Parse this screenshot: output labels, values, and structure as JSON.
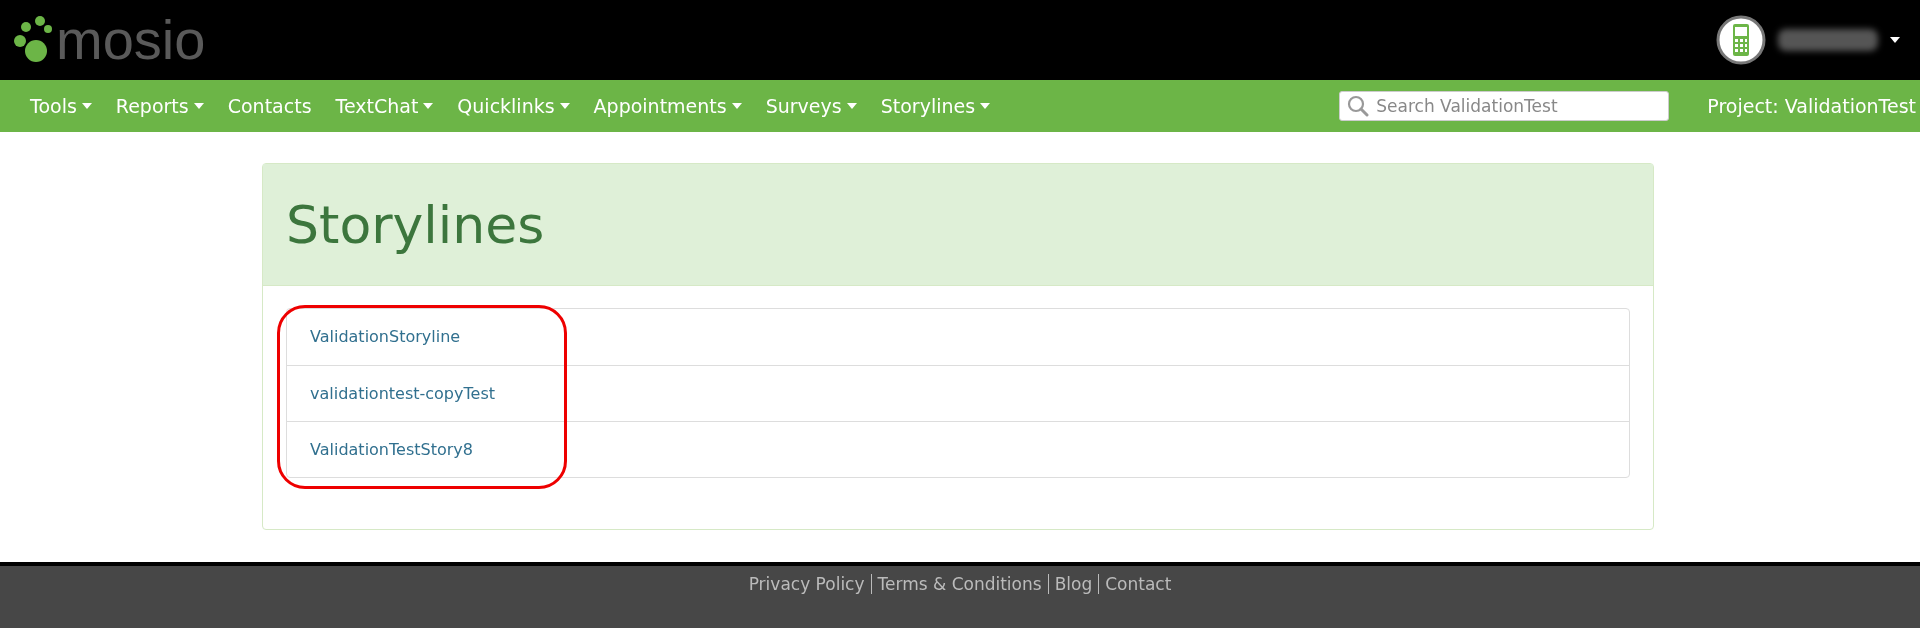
{
  "header": {
    "logo": "mosio"
  },
  "nav": {
    "items": [
      {
        "label": "Tools",
        "dropdown": true
      },
      {
        "label": "Reports",
        "dropdown": true
      },
      {
        "label": "Contacts",
        "dropdown": false
      },
      {
        "label": "TextChat",
        "dropdown": true
      },
      {
        "label": "Quicklinks",
        "dropdown": true
      },
      {
        "label": "Appointments",
        "dropdown": true
      },
      {
        "label": "Surveys",
        "dropdown": true
      },
      {
        "label": "Storylines",
        "dropdown": true
      }
    ],
    "search": {
      "placeholder": "Search ValidationTest"
    },
    "project": "Project: ValidationTest"
  },
  "page": {
    "title": "Storylines",
    "storylines": [
      "ValidationStoryline",
      "validationtest-copyTest",
      "ValidationTestStory8"
    ]
  },
  "footer": {
    "links": [
      "Privacy Policy",
      "Terms & Conditions",
      "Blog",
      "Contact"
    ]
  }
}
